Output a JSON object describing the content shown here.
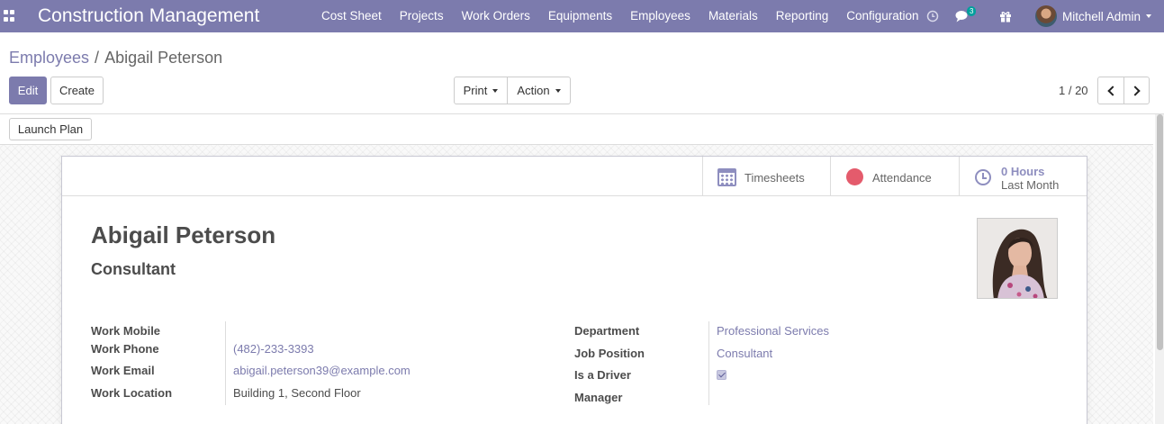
{
  "app": {
    "title": "Construction Management"
  },
  "nav": {
    "menus": [
      {
        "label": "Cost Sheet"
      },
      {
        "label": "Projects"
      },
      {
        "label": "Work Orders"
      },
      {
        "label": "Equipments"
      },
      {
        "label": "Employees"
      },
      {
        "label": "Materials"
      },
      {
        "label": "Reporting"
      },
      {
        "label": "Configuration"
      }
    ],
    "messages_badge": "3",
    "user_name": "Mitchell Admin",
    "icons": [
      "apps-icon",
      "activity-clock-icon",
      "chat-icon",
      "gift-icon"
    ]
  },
  "breadcrumb": {
    "parent": "Employees",
    "separator": "/",
    "current": "Abigail Peterson"
  },
  "toolbar": {
    "edit_label": "Edit",
    "create_label": "Create",
    "print_label": "Print",
    "action_label": "Action"
  },
  "pager": {
    "value": "1 / 20"
  },
  "statusbar": {
    "launch_plan_label": "Launch Plan"
  },
  "smart_buttons": {
    "timesheets_label": "Timesheets",
    "attendance_label": "Attendance",
    "hours_value": "0 Hours",
    "hours_label": "Last Month"
  },
  "employee": {
    "name": "Abigail Peterson",
    "job_title": "Consultant"
  },
  "fields": {
    "work_mobile_label": "Work Mobile",
    "work_mobile": "",
    "work_phone_label": "Work Phone",
    "work_phone": "(482)-233-3393",
    "work_email_label": "Work Email",
    "work_email": "abigail.peterson39@example.com",
    "work_location_label": "Work Location",
    "work_location": "Building 1, Second Floor",
    "department_label": "Department",
    "department": "Professional Services",
    "job_position_label": "Job Position",
    "job_position": "Consultant",
    "is_driver_label": "Is a Driver",
    "is_driver": true,
    "manager_label": "Manager",
    "manager": ""
  },
  "colors": {
    "brand": "#7c7bad",
    "badge": "#00a09d",
    "attendance_dot": "#e45b6c"
  }
}
